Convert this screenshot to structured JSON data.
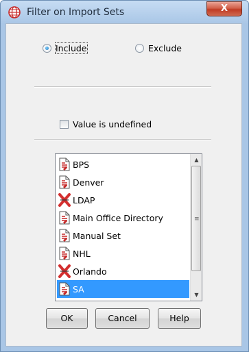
{
  "window": {
    "title": "Filter on Import Sets",
    "close_glyph": "X"
  },
  "mode": {
    "options": [
      {
        "label": "Include",
        "checked": true
      },
      {
        "label": "Exclude",
        "checked": false
      }
    ]
  },
  "undefined_filter": {
    "label": "Value is undefined",
    "checked": false
  },
  "import_sets": {
    "items": [
      {
        "label": "BPS",
        "icon": "import-set-document-icon",
        "selected": false
      },
      {
        "label": "Denver",
        "icon": "import-set-document-icon",
        "selected": false
      },
      {
        "label": "LDAP",
        "icon": "disabled-x-icon",
        "selected": false
      },
      {
        "label": "Main Office Directory",
        "icon": "import-set-document-icon",
        "selected": false
      },
      {
        "label": "Manual Set",
        "icon": "import-set-document-icon",
        "selected": false
      },
      {
        "label": "NHL",
        "icon": "import-set-document-icon",
        "selected": false
      },
      {
        "label": "Orlando",
        "icon": "disabled-x-icon",
        "selected": false
      },
      {
        "label": "SA",
        "icon": "import-set-document-icon",
        "selected": true
      }
    ],
    "scroll_grip": "≡"
  },
  "buttons": {
    "ok": "OK",
    "cancel": "Cancel",
    "help": "Help"
  },
  "colors": {
    "selection": "#3399ff",
    "dialog_bg": "#f0f0f0",
    "frame": "#a9c6e6",
    "close": "#c7412a"
  }
}
